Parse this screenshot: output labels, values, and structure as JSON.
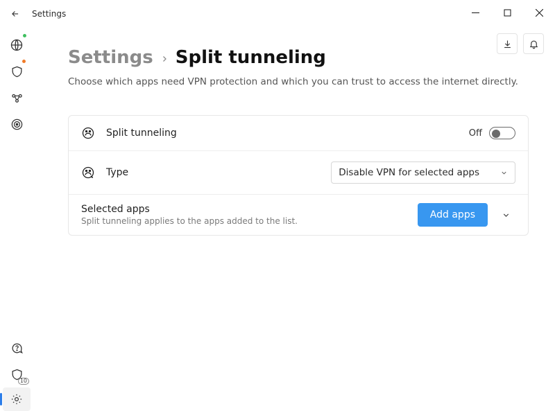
{
  "titlebar": {
    "app_name": "Settings"
  },
  "breadcrumb": {
    "root": "Settings",
    "current": "Split tunneling"
  },
  "subtitle": "Choose which apps need VPN protection and which you can trust to access the internet directly.",
  "rows": {
    "split_tunneling": {
      "label": "Split tunneling",
      "state_text": "Off"
    },
    "type": {
      "label": "Type",
      "selected": "Disable VPN for selected apps"
    },
    "selected_apps": {
      "title": "Selected apps",
      "subtitle": "Split tunneling applies to the apps added to the list.",
      "button": "Add apps"
    }
  },
  "sidebar_icons": [
    "globe",
    "shield",
    "chain",
    "target",
    "help",
    "shield-count",
    "gear"
  ],
  "header_icons": [
    "download",
    "bell"
  ]
}
